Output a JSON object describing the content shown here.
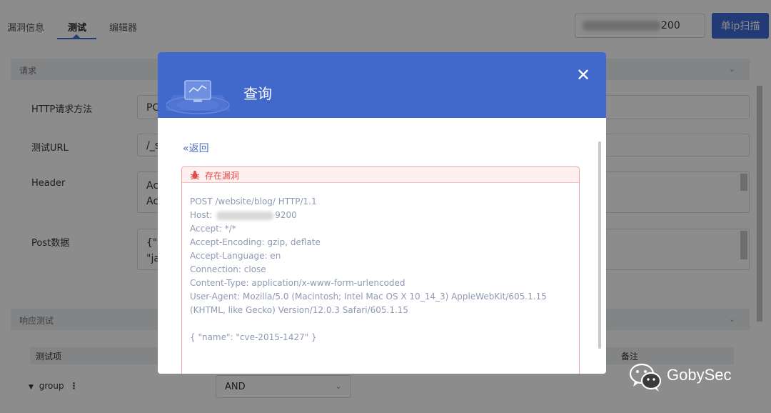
{
  "tabs": [
    {
      "label": "漏洞信息"
    },
    {
      "label": "测试"
    },
    {
      "label": "编辑器"
    }
  ],
  "ip_input": {
    "visible_suffix": "200"
  },
  "scan_button": {
    "label": "单ip扫描"
  },
  "request_section": {
    "title": "请求"
  },
  "form": {
    "method_label": "HTTP请求方法",
    "method_value": "PO",
    "url_label": "测试URL",
    "url_value": "/_s",
    "header_label": "Header",
    "header_value": "Ac\nAc",
    "post_label": "Post数据",
    "post_value": "{\"s\n\"ja"
  },
  "response_section": {
    "title": "响应测试"
  },
  "table": {
    "col_test_item": "测试项",
    "col_note": "备注",
    "group_label": "group",
    "operator_value": "AND"
  },
  "modal": {
    "title": "查询",
    "back_label": "«返回",
    "vuln_title": "存在漏洞",
    "request_lines": [
      "POST /website/blog/ HTTP/1.1",
      "Host: ",
      "Accept: */*",
      "Accept-Encoding: gzip, deflate",
      "Accept-Language: en",
      "Connection: close",
      "Content-Type: application/x-www-form-urlencoded",
      "User-Agent: Mozilla/5.0 (Macintosh; Intel Mac OS X 10_14_3) AppleWebKit/605.1.15 (KHTML, like Gecko) Version/12.0.3 Safari/605.1.15",
      "",
      "{ \"name\": \"cve-2015-1427\" }"
    ],
    "host_suffix": "9200"
  },
  "watermark": {
    "text": "GobySec"
  },
  "colors": {
    "primary": "#4169cc",
    "danger": "#e04b4b",
    "danger_border": "#f0a5a5"
  }
}
